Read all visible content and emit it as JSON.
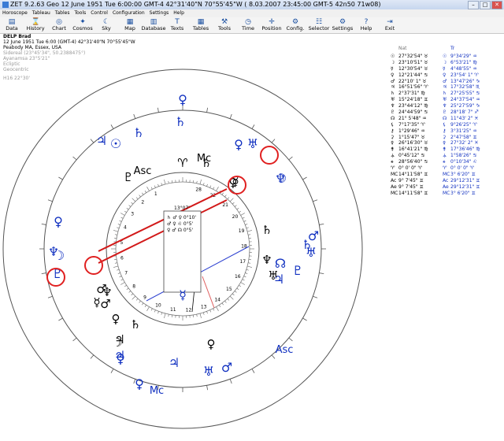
{
  "window": {
    "title": "ZET 9.2.63 Geo    12 June 1951   Tue    6:00:00 GMT-4 42°31'40\"N  70°55'45\"W   ( 8.03.2007  23:45:00 GMT-5 42n50 71w08)"
  },
  "menu": [
    "Horoscope",
    "Tableau",
    "Tables",
    "Tools",
    "Control",
    "Configuration",
    "Settings",
    "Help"
  ],
  "toolbar": [
    {
      "label": "Data",
      "icon": "data-icon",
      "glyph": "▤"
    },
    {
      "label": "History",
      "icon": "history-icon",
      "glyph": "⌛"
    },
    {
      "label": "Chart",
      "icon": "chart-icon",
      "glyph": "◎"
    },
    {
      "label": "Cosmos",
      "icon": "cosmos-icon",
      "glyph": "✦"
    },
    {
      "label": "Sky",
      "icon": "sky-icon",
      "glyph": "☾"
    },
    {
      "label": "Map",
      "icon": "map-icon",
      "glyph": "▦"
    },
    {
      "label": "Database",
      "icon": "database-icon",
      "glyph": "▥"
    },
    {
      "label": "Texts",
      "icon": "texts-icon",
      "glyph": "T"
    },
    {
      "label": "Tables",
      "icon": "tables-icon",
      "glyph": "▦"
    },
    {
      "label": "Tools",
      "icon": "tools-icon",
      "glyph": "⚒"
    },
    {
      "label": "Time",
      "icon": "time-icon",
      "glyph": "◷"
    },
    {
      "label": "Position",
      "icon": "position-icon",
      "glyph": "✛"
    },
    {
      "label": "Config.",
      "icon": "config-icon",
      "glyph": "⚙"
    },
    {
      "label": "Selector",
      "icon": "selector-icon",
      "glyph": "☷"
    },
    {
      "label": "Settings",
      "icon": "settings-icon",
      "glyph": "⚙"
    },
    {
      "label": "Help",
      "icon": "help-icon",
      "glyph": "?"
    },
    {
      "label": "Exit",
      "icon": "exit-icon",
      "glyph": "⇥"
    }
  ],
  "info": {
    "name": "DELP Brad",
    "datetime": "12 June 1951   Tue    6:00 (GMT-4) 42°31'40\"N   70°55'45\"W",
    "place": "Peabody MA, Essex, USA",
    "zodiac": "Sidereal (23°45'34\", 50.2388475°)",
    "ayanamsa": "Ayanamsa 23°5'21\"",
    "ecliptic": "Ecliptic",
    "geocentric": "Geocentric",
    "harmonic": "H16  22°30'"
  },
  "chart": {
    "midpoint_box": {
      "title": "13°07'",
      "lines": [
        "♄ ♂ ♀ 0°10'",
        "♂ ♀ ♌ 0°5'",
        "♀ ♂ ☊ 0°5'"
      ]
    },
    "outer_glyphs": [
      "♀",
      "♄",
      "♃",
      "☉",
      "♄",
      "♅",
      "♆",
      "☽",
      "♀",
      "♂",
      "♅",
      "☊",
      "♃",
      "♄",
      "♇",
      "☿",
      "♀",
      "♂",
      "♅",
      "♃",
      "♀",
      "☽",
      "♆",
      "♇",
      "♀",
      "♃"
    ],
    "inner_glyphs": [
      "♇",
      "♈",
      "♀",
      "♄",
      "♄",
      "☿",
      "♆",
      "♂",
      "☿",
      "♀",
      "♄",
      "♂",
      "♃",
      "☽",
      "♆",
      "♅",
      "♀"
    ],
    "angle_labels": [
      "Asc",
      "Mc",
      "Asc",
      "Mc"
    ],
    "inner_numbers": [
      "28",
      "22",
      "21",
      "20",
      "19",
      "18",
      "17",
      "16",
      "15",
      "14",
      "13",
      "12",
      "11",
      "10",
      "9",
      "8",
      "7",
      "6",
      "5",
      "4",
      "3",
      "2",
      "1"
    ]
  },
  "planets": {
    "header_natal": "Nat",
    "header_transit": "Tr",
    "rows": [
      {
        "g1": "☉",
        "n": "27°32'54\" ♉",
        "g2": "☉",
        "t": "9°34'29\" ♒"
      },
      {
        "g1": "☽",
        "n": "23°10'51\" ♉",
        "g2": "☽",
        "t": "6°53'21\" ♍"
      },
      {
        "g1": "☿",
        "n": "12°30'54\" ♉",
        "g2": "☿",
        "t": "4°48'55\" ♒"
      },
      {
        "g1": "♀",
        "n": "12°21'44\" ♋",
        "g2": "♀",
        "t": "23°54' 1\" ♈"
      },
      {
        "g1": "♂",
        "n": "22°10' 1\" ♉",
        "g2": "♂",
        "t": "13°47'26\" ♑"
      },
      {
        "g1": "♃",
        "n": "16°51'56\" ♈",
        "g2": "♃",
        "t": "17°32'58\" ♏"
      },
      {
        "g1": "♄",
        "n": "2°37'31\" ♍",
        "g2": "♄",
        "t": "27°25'55\" ♋"
      },
      {
        "g1": "♅",
        "n": "15°24'18\" ♊",
        "g2": "♅",
        "t": "24°37'54\" ♒"
      },
      {
        "g1": "♆",
        "n": "23°44'12\" ♍",
        "g2": "♆",
        "t": "25°27'59\" ♑"
      },
      {
        "g1": "♇",
        "n": "24°44'59\" ♋",
        "g2": "♇",
        "t": "28°18' 7\" ♐"
      },
      {
        "g1": "☊",
        "n": "21° 5'48\" ♒",
        "g2": "☊",
        "t": "11°43' 2\" ♓"
      },
      {
        "g1": "⚸",
        "n": "7°17'35\" ♈",
        "g2": "⚸",
        "t": "9°26'25\" ♈"
      },
      {
        "g1": "⚷",
        "n": "1°29'46\" ♒",
        "g2": "⚷",
        "t": "3°31'25\" ♒"
      },
      {
        "g1": "⚳",
        "n": "1°15'47\" ♉",
        "g2": "⚳",
        "t": "2°47'58\" ♊"
      },
      {
        "g1": "⚴",
        "n": "26°16'30\" ♉",
        "g2": "⚴",
        "t": "27°32' 2\" ♓"
      },
      {
        "g1": "⚵",
        "n": "16°41'21\" ♍",
        "g2": "⚵",
        "t": "17°36'46\" ♍"
      },
      {
        "g1": "⚶",
        "n": "0°45'12\" ♋",
        "g2": "⚶",
        "t": "1°58'26\" ♋"
      },
      {
        "g1": "⚹",
        "n": "28°56'40\" ♋",
        "g2": "⚹",
        "t": "0°10'34\" ♌"
      },
      {
        "g1": "♈",
        "n": "0° 0' 0\" ♈",
        "g2": "♈",
        "t": "0° 0' 0\" ♈"
      },
      {
        "g1": "MC",
        "n": "14°11'58\" ♊",
        "g2": "MC",
        "t": "3° 6'20\" ♊"
      },
      {
        "g1": "Ac",
        "n": "9° 7'45\" ♊",
        "g2": "Ac",
        "t": "29°12'31\" ♊"
      },
      {
        "g1": "Ae",
        "n": "9° 7'45\" ♊",
        "g2": "Ae",
        "t": "29°12'31\" ♊"
      },
      {
        "g1": "MC",
        "n": "14°11'58\" ♊",
        "g2": "MC",
        "t": "3° 6'20\" ♊"
      }
    ]
  },
  "colors": {
    "natal": "#000000",
    "transit": "#1030c0",
    "highlight": "#e02020",
    "aspect_red": "#d21919",
    "aspect_blue": "#2b3fd0"
  }
}
